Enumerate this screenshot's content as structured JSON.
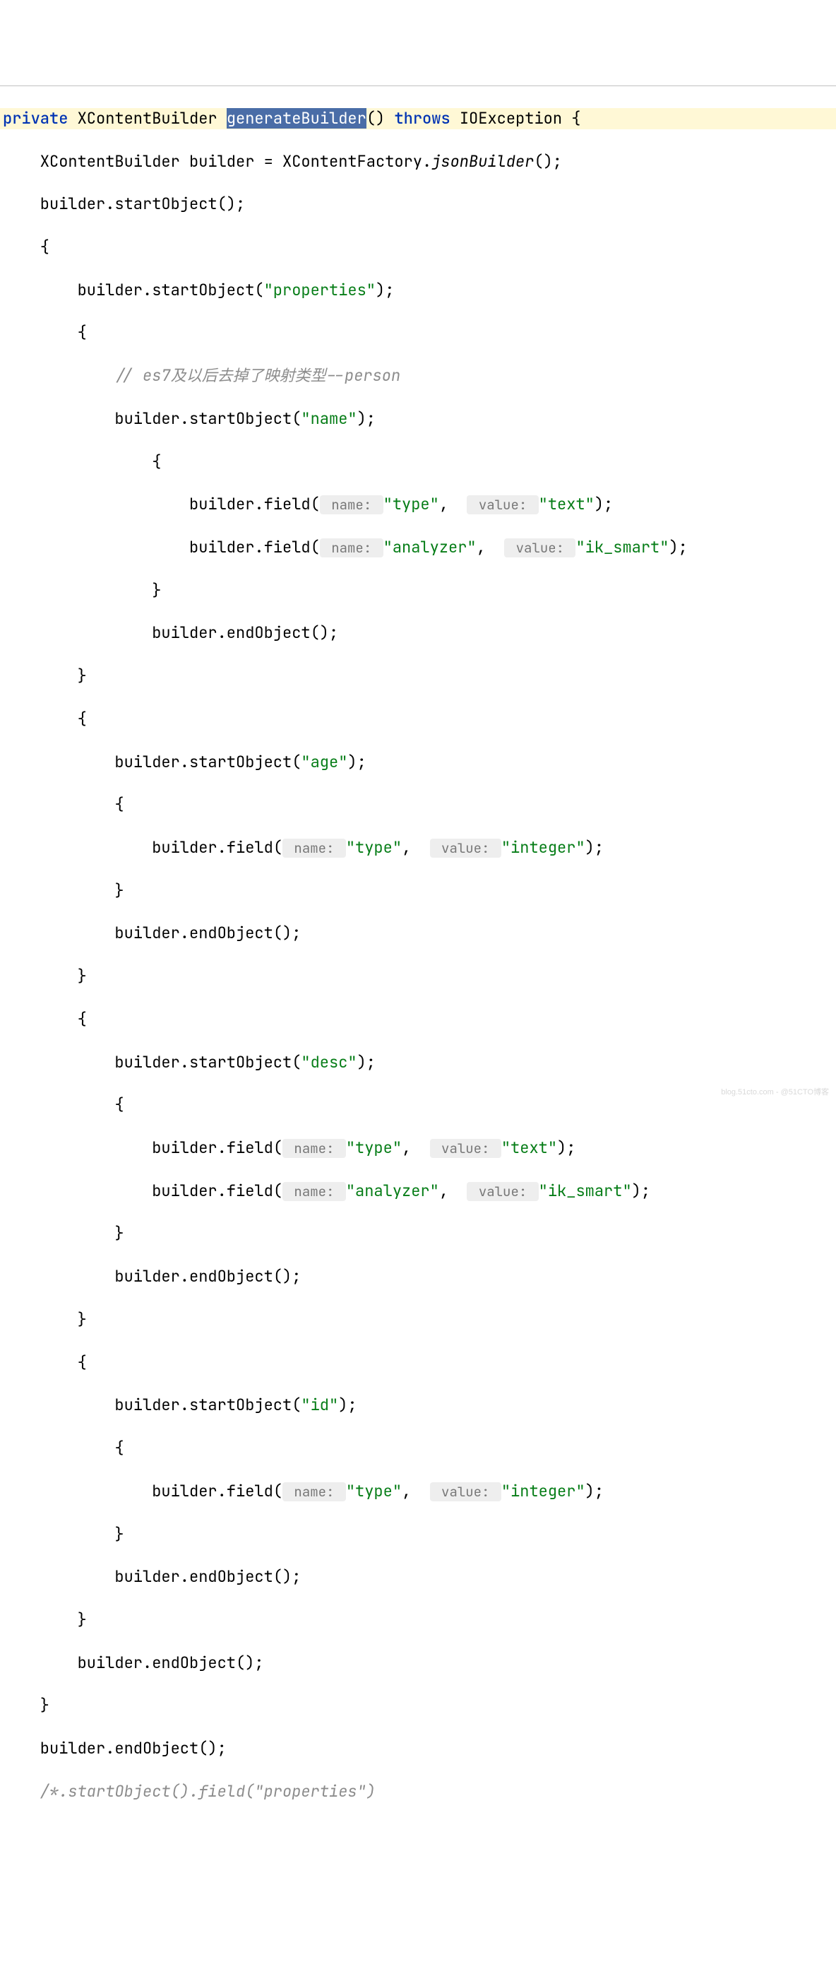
{
  "signature": {
    "modifier": "private",
    "returnType": "XContentBuilder",
    "methodName": "generateBuilder",
    "parens": "()",
    "throwsKw": "throws",
    "exception": "IOException",
    "brace": " {"
  },
  "lines": {
    "l2a": "    XContentBuilder builder = XContentFactory.",
    "l2b": "jsonBuilder",
    "l2c": "();",
    "l3": "    builder.startObject();",
    "l4": "    {",
    "l5a": "        builder.startObject(",
    "l5b": "\"properties\"",
    "l5c": ");",
    "l6": "        {",
    "l7": "            // es7及以后去掉了映射类型--person",
    "l8a": "            builder.startObject(",
    "l8b": "\"name\"",
    "l8c": ");",
    "l9": "                {",
    "l10a": "                    builder.field(",
    "l10b": "\"type\"",
    "l10c": ", ",
    "l10d": "\"text\"",
    "l10e": ");",
    "l11a": "                    builder.field(",
    "l11b": "\"analyzer\"",
    "l11c": ", ",
    "l11d": "\"ik_smart\"",
    "l11e": ");",
    "l12": "                }",
    "l13": "                builder.endObject();",
    "l14": "        }",
    "l15": "        {",
    "l16a": "            builder.startObject(",
    "l16b": "\"age\"",
    "l16c": ");",
    "l17": "            {",
    "l18a": "                builder.field(",
    "l18b": "\"type\"",
    "l18c": ", ",
    "l18d": "\"integer\"",
    "l18e": ");",
    "l19": "            }",
    "l20": "            builder.endObject();",
    "l21": "        }",
    "l22": "        {",
    "l23a": "            builder.startObject(",
    "l23b": "\"desc\"",
    "l23c": ");",
    "l24": "            {",
    "l25a": "                builder.field(",
    "l25b": "\"type\"",
    "l25c": ", ",
    "l25d": "\"text\"",
    "l25e": ");",
    "l26a": "                builder.field(",
    "l26b": "\"analyzer\"",
    "l26c": ", ",
    "l26d": "\"ik_smart\"",
    "l26e": ");",
    "l27": "            }",
    "l28": "            builder.endObject();",
    "l29": "        }",
    "l30": "        {",
    "l31a": "            builder.startObject(",
    "l31b": "\"id\"",
    "l31c": ");",
    "l32": "            {",
    "l33a": "                builder.field(",
    "l33b": "\"type\"",
    "l33c": ", ",
    "l33d": "\"integer\"",
    "l33e": ");",
    "l34": "            }",
    "l35": "            builder.endObject();",
    "l36": "        }",
    "l37": "        builder.endObject();",
    "l38": "    }",
    "l39": "    builder.endObject();",
    "l40": "    /*.startObject().field(\"properties\")"
  },
  "hints": {
    "name": " name: ",
    "value": " value: "
  },
  "watermark": "blog.51cto.com - @51CTO博客"
}
